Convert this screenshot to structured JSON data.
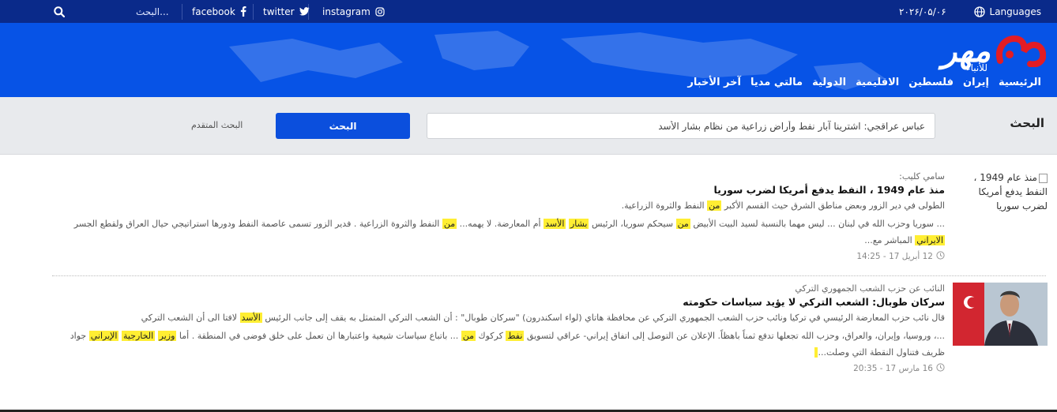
{
  "topbar": {
    "languages_label": "Languages",
    "date": "۲۰۲۶/۰۵/۰۶",
    "social": [
      {
        "label": "instagram",
        "icon": "instagram-icon"
      },
      {
        "label": "twitter",
        "icon": "twitter-icon"
      },
      {
        "label": "facebook",
        "icon": "facebook-icon"
      }
    ],
    "search_placeholder": "البحث...",
    "colors": {
      "bar": "#0a2a8a",
      "header": "#0753e6",
      "accent": "#e21c24"
    }
  },
  "header": {
    "logo_text": "مهر",
    "logo_sub": "للأنباء",
    "nav": [
      "الرئيسية",
      "إيران",
      "فلسطين",
      "الاقليمية",
      "الدولية",
      "مالتي مديا",
      "آخر الأخبار"
    ]
  },
  "search": {
    "title": "البحث",
    "query": "عباس عراقجي: اشترينا آبار نفط وأراض زراعية من نظام بشار الأسد",
    "button_label": "البحث",
    "advanced_label": "البحث المتقدم"
  },
  "results": [
    {
      "thumb_alt": "منذ عام 1949 ، النفط يدفع أمريكا لضرب سوريا",
      "lead": "سامي كليب:",
      "title": "منذ عام 1949 ، النفط يدفع أمريكا لضرب سوريا",
      "summary": [
        "الطولى في  دير الزور وبعض مناطق الشرق حيث القسم الأكبر ",
        "من",
        " النفط والثروة الزراعية."
      ],
      "snippet": [
        "... سوريا وحزب الله في لبنان ... ليس مهما بالنسبة لسيد البيت الأبيض ",
        "من",
        " سيحكم سوريا، الرئيس ",
        "بشار",
        " ",
        "الأسد",
        " أم المعارضة. لا يهمه... ",
        "من",
        " النفط والثروة الزراعية . فدير الزور تسمى عاصمة النفط ودورها استراتيجي حيال العراق ولقطع الجسر ",
        "الايراني",
        " المباشر مع..."
      ],
      "date": "12 أبريل 17 - 14:25"
    },
    {
      "thumb_alt": "",
      "lead": "النائب عن حزب الشعب الجمهوري التركي",
      "title": "سركان طوبال: الشعب التركي لا يؤيد سياسات حكومته",
      "summary": [
        "قال نائب حزب المعارضة الرئيسي في تركيا ونائب حزب الشعب الجمهوري التركي عن محافظة هاتاي (لواء اسكندرون) \"سركان طوبال\" : أن الشعب التركي المتمثل به يقف إلى جانب الرئيس ",
        "الأسد",
        " لافتا الى أن الشعب التركي"
      ],
      "snippet": [
        "...، وروسيا، وإيران، والعراق، وحزب الله تجعلها تدفع ثمناً باهظاً. الإعلان عن التوصل إلى اتفاق إيراني- عراقي لتسويق ",
        "نفط",
        " كركوك ",
        "من",
        " ... باتباع سياسات شيعية واعتبارها ان تعمل على خلق فوضى في المنطقة . أما ",
        "وزير",
        " ",
        "الخارجية",
        " ",
        "الإيراني",
        " جواد ظريف فتناول النقطة التي وصلت..."
      ],
      "date": "16 مارس 17 - 20:35"
    }
  ]
}
